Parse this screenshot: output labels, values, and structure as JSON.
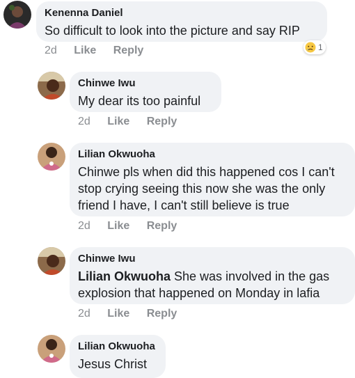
{
  "comments": [
    {
      "author": "Kenenna Daniel",
      "text": "So difficult to look into the picture and say RIP",
      "time": "2d",
      "like": "Like",
      "reply": "Reply",
      "reaction_count": "1"
    },
    {
      "author": "Chinwe Iwu",
      "text": "My dear its too painful",
      "time": "2d",
      "like": "Like",
      "reply": "Reply"
    },
    {
      "author": "Lilian Okwuoha",
      "text": "Chinwe pls when did this happened cos I can't stop crying seeing this now she was the only friend I have, I can't still believe is true",
      "time": "2d",
      "like": "Like",
      "reply": "Reply"
    },
    {
      "author": "Chinwe Iwu",
      "mention": "Lilian Okwuoha",
      "text": " She was involved in the gas explosion that happened on Monday in lafia",
      "time": "2d",
      "like": "Like",
      "reply": "Reply"
    },
    {
      "author": "Lilian Okwuoha",
      "text": "Jesus Christ"
    }
  ],
  "reaction_icon": "sad-face-icon",
  "colors": {
    "bubble": "#f0f2f5",
    "meta": "#8a8d91",
    "text": "#1c1e21"
  }
}
